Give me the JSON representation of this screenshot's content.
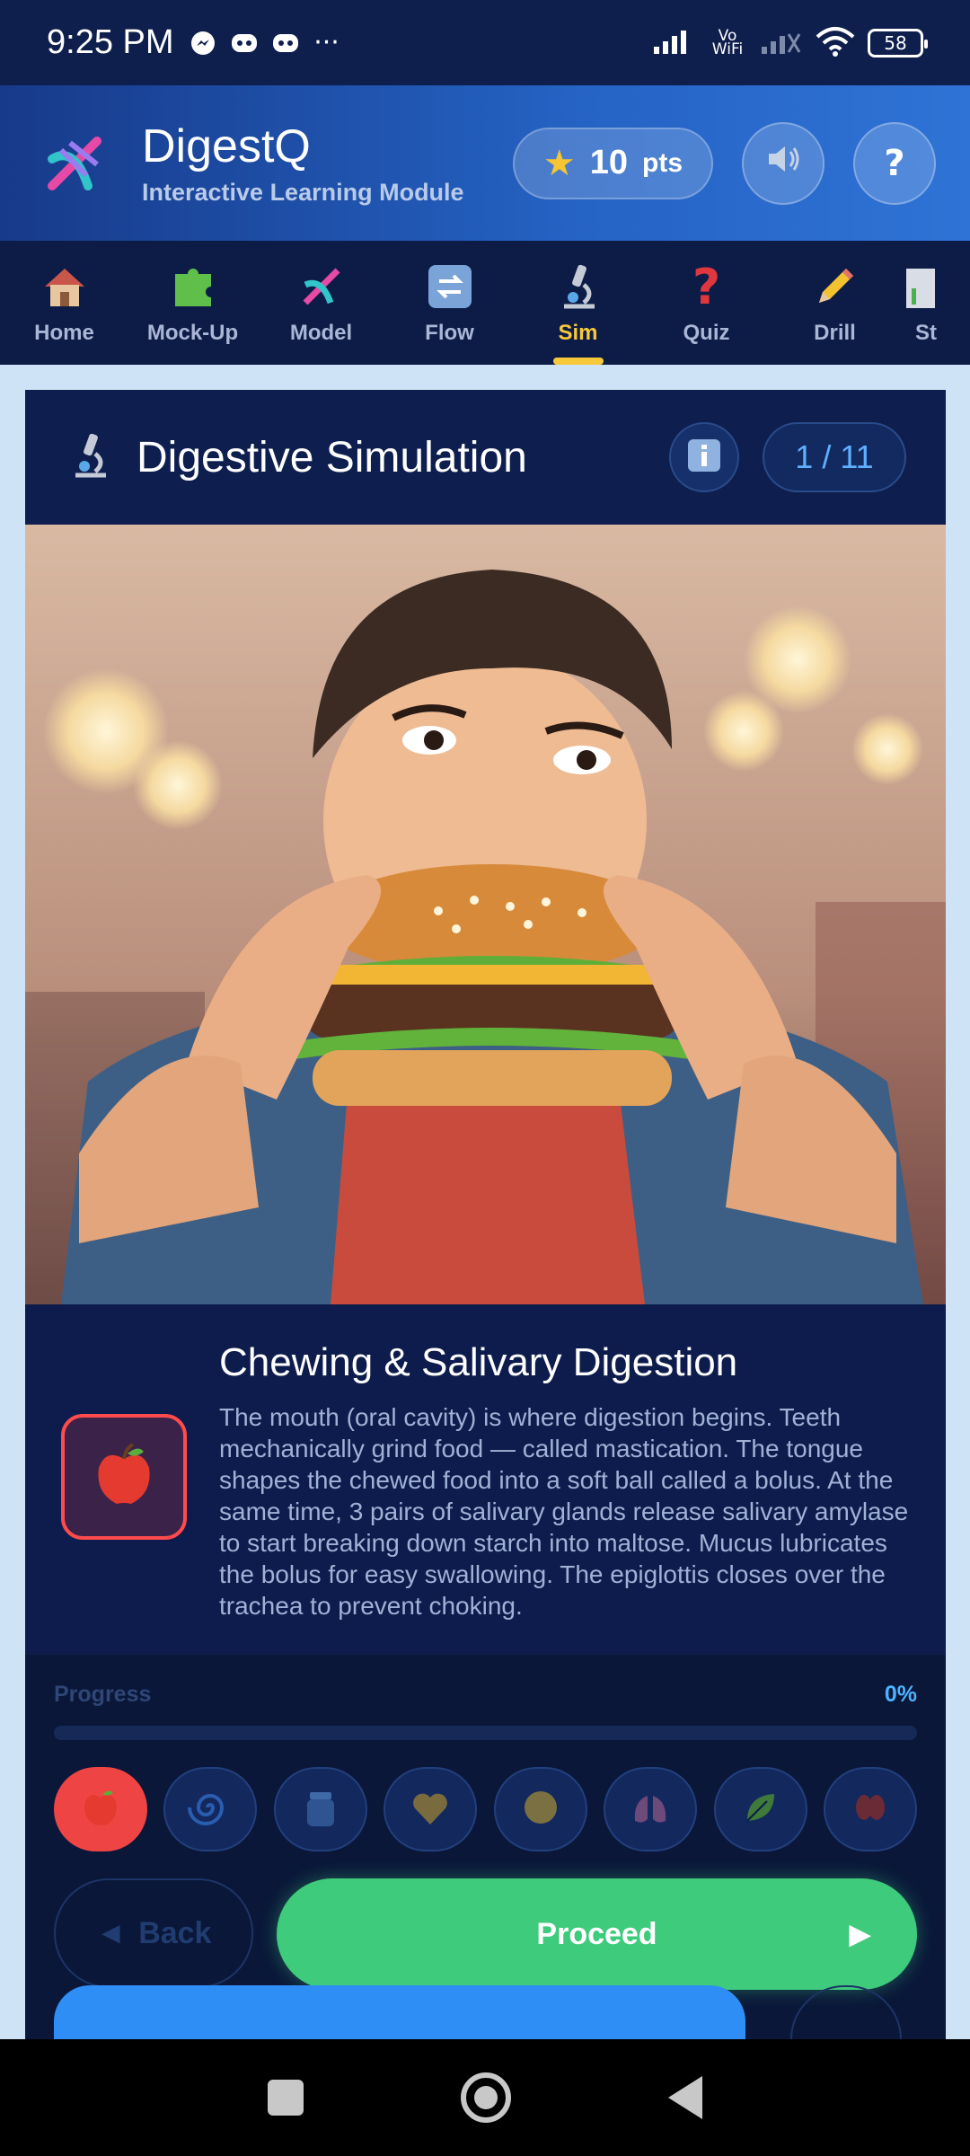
{
  "status_bar": {
    "time": "9:25 PM",
    "network_label": "Vo WiFi",
    "battery": "58"
  },
  "header": {
    "title": "DigestQ",
    "subtitle": "Interactive Learning Module",
    "points_value": "10",
    "points_unit": "pts",
    "help_label": "?"
  },
  "tabs": [
    {
      "label": "Home",
      "icon": "house-icon"
    },
    {
      "label": "Mock-Up",
      "icon": "puzzle-icon"
    },
    {
      "label": "Model",
      "icon": "dna-icon"
    },
    {
      "label": "Flow",
      "icon": "refresh-icon"
    },
    {
      "label": "Sim",
      "icon": "microscope-icon",
      "active": true
    },
    {
      "label": "Quiz",
      "icon": "question-icon"
    },
    {
      "label": "Drill",
      "icon": "pencil-icon"
    },
    {
      "label": "St",
      "icon": "chart-icon"
    }
  ],
  "card": {
    "title": "Digestive Simulation",
    "page_indicator": "1 / 11",
    "stage": {
      "title": "Chewing & Salivary Digestion",
      "description": "The mouth (oral cavity) is where digestion begins. Teeth mechanically grind food — called mastication. The tongue shapes the chewed food into a soft ball called a bolus. At the same time, 3 pairs of salivary glands release salivary amylase to start breaking down starch into maltose. Mucus lubricates the bolus for easy swallowing. The epiglottis closes over the trachea to prevent choking.",
      "icon": "apple-icon"
    },
    "progress": {
      "label": "Progress",
      "value_text": "0%",
      "fraction": 0
    },
    "stages": [
      "apple-icon",
      "spiral-icon",
      "jar-icon",
      "heart-icon",
      "blob-icon",
      "lungs-icon",
      "leaf-icon",
      "kidney-icon"
    ],
    "back_label": "Back",
    "proceed_label": "Proceed"
  },
  "colors": {
    "accent_green": "#3ecb7b",
    "accent_yellow": "#f7c93a",
    "stage_red": "#ef4444"
  }
}
